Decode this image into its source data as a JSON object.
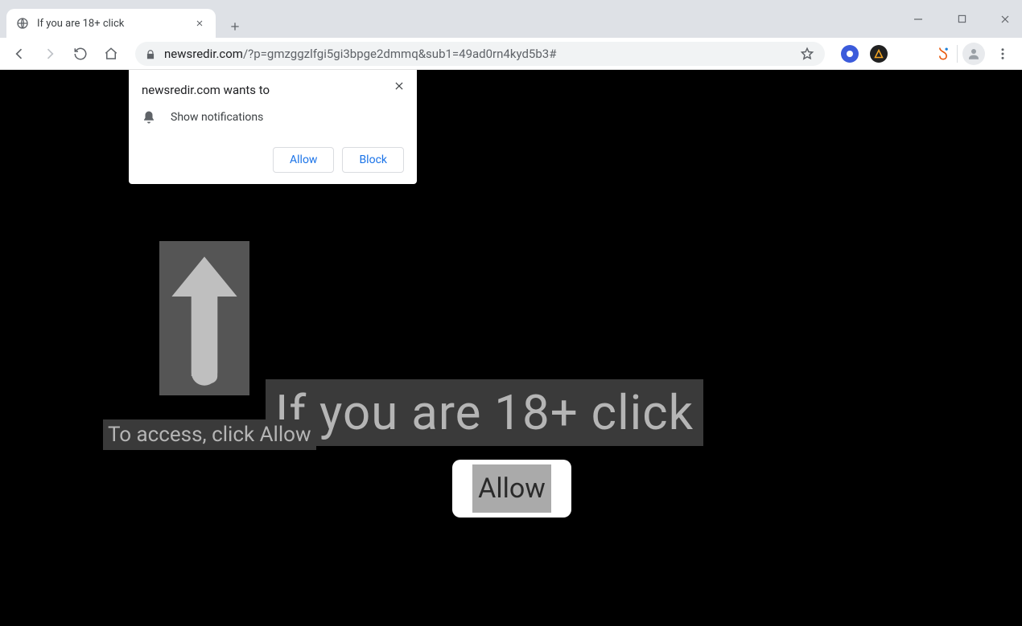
{
  "window": {
    "tab_title": "If you are 18+ click"
  },
  "address_bar": {
    "domain": "newsredir.com",
    "path": "/?p=gmzggzlfgi5gi3bpge2dmmq&sub1=49ad0rn4kyd5b3#"
  },
  "permission_prompt": {
    "title": "newsredir.com wants to",
    "request_text": "Show notifications",
    "allow_label": "Allow",
    "block_label": "Block"
  },
  "page": {
    "instruction_small": "To access, click Allow",
    "instruction_large": "If you are 18+ click",
    "fake_button_label": "Allow"
  },
  "colors": {
    "chrome_bg": "#dee1e6",
    "link_blue": "#1a73e8",
    "content_bg": "#000000"
  }
}
